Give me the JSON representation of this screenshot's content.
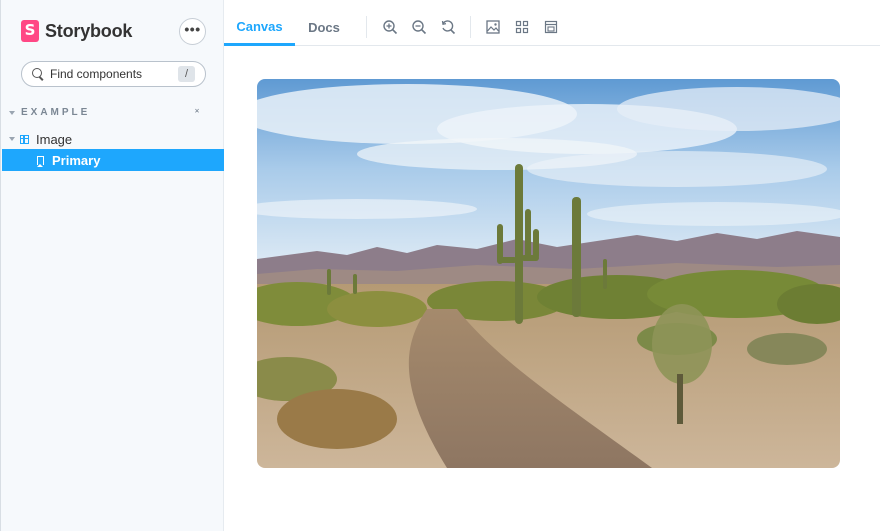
{
  "app": {
    "brand": "Storybook",
    "menu_label": "•••"
  },
  "search": {
    "placeholder": "Find components",
    "shortcut": "/"
  },
  "sidebar": {
    "section": "EXAMPLE",
    "component": "Image",
    "story": "Primary"
  },
  "toolbar": {
    "tabs": [
      "Canvas",
      "Docs"
    ],
    "active_tab": "Canvas",
    "tools": [
      "zoom-in-icon",
      "zoom-out-icon",
      "zoom-reset-icon",
      "background-icon",
      "grid-icon",
      "viewport-icon"
    ]
  },
  "colors": {
    "accent": "#1ea7fd",
    "brand": "#ff4785",
    "sidebar_bg": "#f6f9fc"
  },
  "preview": {
    "subject": "desert-landscape-image"
  }
}
